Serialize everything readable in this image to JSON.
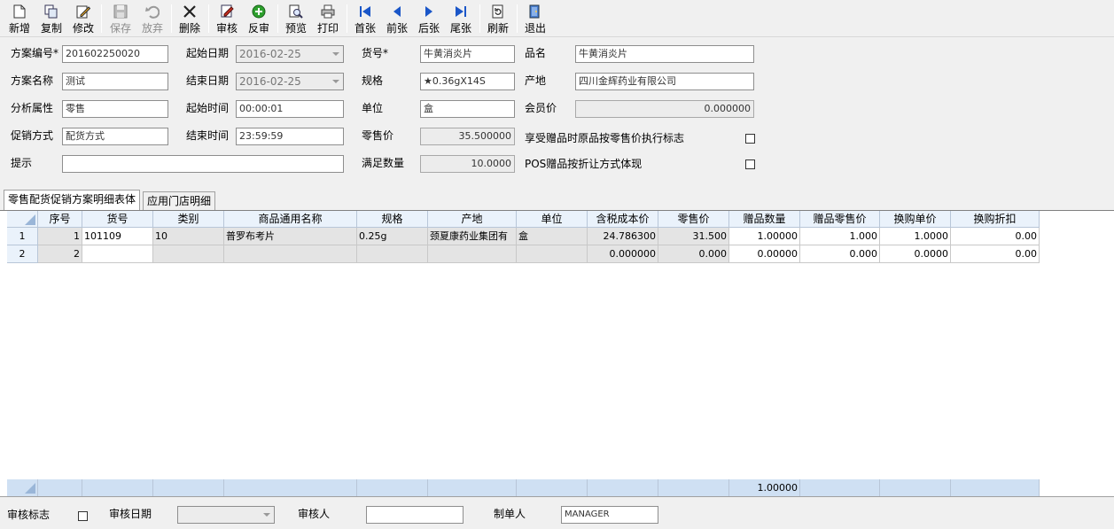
{
  "toolbar": {
    "new": "新增",
    "copy": "复制",
    "edit": "修改",
    "save": "保存",
    "discard": "放弃",
    "delete": "删除",
    "approve": "审核",
    "unapprove": "反审",
    "preview": "预览",
    "print": "打印",
    "first": "首张",
    "prev": "前张",
    "next": "后张",
    "last": "尾张",
    "refresh": "刷新",
    "exit": "退出"
  },
  "form": {
    "plan_no_label": "方案编号*",
    "plan_no": "201602250020",
    "plan_name_label": "方案名称",
    "plan_name": "测试",
    "analysis_label": "分析属性",
    "analysis": "零售",
    "promo_label": "促销方式",
    "promo": "配货方式",
    "hint_label": "提示",
    "hint": "",
    "start_date_label": "起始日期",
    "start_date": "2016-02-25",
    "end_date_label": "结束日期",
    "end_date": "2016-02-25",
    "start_time_label": "起始时间",
    "start_time": "00:00:01",
    "end_time_label": "结束时间",
    "end_time": "23:59:59",
    "item_no_label": "货号*",
    "item_no": "牛黄消炎片",
    "spec_label": "规格",
    "spec": "★0.36gX14S",
    "unit_label": "单位",
    "unit": "盒",
    "retail_label": "零售价",
    "retail": "35.500000",
    "min_qty_label": "满足数量",
    "min_qty": "10.0000",
    "product_label": "品名",
    "product": "牛黄消炎片",
    "origin_label": "产地",
    "origin": "四川金辉药业有限公司",
    "member_label": "会员价",
    "member": "0.000000",
    "gift_flag_label": "享受赠品时原品按零售价执行标志",
    "pos_flag_label": "POS赠品按折让方式体现"
  },
  "tabs": [
    "零售配货促销方案明细表体",
    "应用门店明细"
  ],
  "grid": {
    "headers": [
      "序号",
      "货号",
      "类别",
      "商品通用名称",
      "规格",
      "产地",
      "单位",
      "含税成本价",
      "零售价",
      "赠品数量",
      "赠品零售价",
      "换购单价",
      "换购折扣"
    ],
    "rows": [
      {
        "rh": "1",
        "c": [
          "1",
          "101109",
          "10",
          "普罗布考片",
          "0.25g",
          "颈夏康药业集团有",
          "盒",
          "24.786300",
          "31.500",
          "1.00000",
          "1.000",
          "1.0000",
          "0.00"
        ]
      },
      {
        "rh": "2",
        "c": [
          "2",
          "",
          "",
          "",
          "",
          "",
          "",
          "0.000000",
          "0.000",
          "0.00000",
          "0.000",
          "0.0000",
          "0.00"
        ]
      }
    ],
    "footer_total": "1.00000"
  },
  "bottom": {
    "audit_flag_label": "审核标志",
    "audit_date_label": "审核日期",
    "audit_date": "",
    "auditor_label": "审核人",
    "auditor": "",
    "creator_label": "制单人",
    "creator": "MANAGER"
  }
}
